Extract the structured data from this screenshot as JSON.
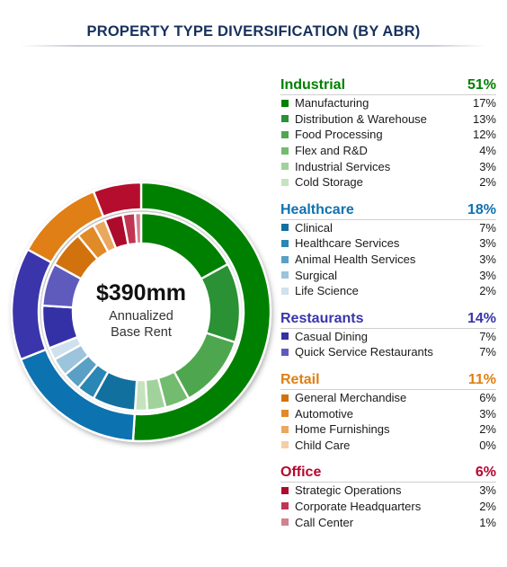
{
  "header": {
    "title": "PROPERTY TYPE DIVERSIFICATION (BY ABR)",
    "title_color": "#17315c"
  },
  "donut": {
    "center": {
      "amount": "$390mm",
      "line1": "Annualized",
      "line2": "Base Rent"
    }
  },
  "chart_data": {
    "type": "pie",
    "title": "PROPERTY TYPE DIVERSIFICATION (BY ABR)",
    "subtype": "nested-donut",
    "center_value": "$390mm",
    "center_label": "Annualized Base Rent",
    "start_angle_deg": 0,
    "direction": "clockwise",
    "units": "percent of ABR",
    "legend_position": "right",
    "groups": [
      {
        "name": "Industrial",
        "total": 51,
        "total_label": "51%",
        "color": "#008000",
        "items": [
          {
            "label": "Manufacturing",
            "value": 17,
            "value_label": "17%",
            "color": "#008000"
          },
          {
            "label": "Distribution & Warehouse",
            "value": 13,
            "value_label": "13%",
            "color": "#2a9134"
          },
          {
            "label": "Food Processing",
            "value": 12,
            "value_label": "12%",
            "color": "#4ea74f"
          },
          {
            "label": "Flex and R&D",
            "value": 4,
            "value_label": "4%",
            "color": "#73bb6f"
          },
          {
            "label": "Industrial Services",
            "value": 3,
            "value_label": "3%",
            "color": "#a2d29b"
          },
          {
            "label": "Cold Storage",
            "value": 2,
            "value_label": "2%",
            "color": "#c6e3bf"
          }
        ]
      },
      {
        "name": "Healthcare",
        "total": 18,
        "total_label": "18%",
        "color": "#1072b0",
        "items": [
          {
            "label": "Clinical",
            "value": 7,
            "value_label": "7%",
            "color": "#12709f"
          },
          {
            "label": "Healthcare Services",
            "value": 3,
            "value_label": "3%",
            "color": "#2a86b4"
          },
          {
            "label": "Animal Health Services",
            "value": 3,
            "value_label": "3%",
            "color": "#5a9fc4"
          },
          {
            "label": "Surgical",
            "value": 3,
            "value_label": "3%",
            "color": "#9cc4dc"
          },
          {
            "label": "Life Science",
            "value": 2,
            "value_label": "2%",
            "color": "#cfe1ed"
          }
        ]
      },
      {
        "name": "Restaurants",
        "total": 14,
        "total_label": "14%",
        "color": "#3a35ab",
        "items": [
          {
            "label": "Casual Dining",
            "value": 7,
            "value_label": "7%",
            "color": "#3430a5"
          },
          {
            "label": "Quick Service Restaurants",
            "value": 7,
            "value_label": "7%",
            "color": "#5f5bbd"
          }
        ]
      },
      {
        "name": "Retail",
        "total": 11,
        "total_label": "11%",
        "color": "#df7f12",
        "items": [
          {
            "label": "General Merchandise",
            "value": 6,
            "value_label": "6%",
            "color": "#d2720d"
          },
          {
            "label": "Automotive",
            "value": 3,
            "value_label": "3%",
            "color": "#e08a28"
          },
          {
            "label": "Home Furnishings",
            "value": 2,
            "value_label": "2%",
            "color": "#eaa85f"
          },
          {
            "label": "Child Care",
            "value": 0,
            "value_label": "0%",
            "color": "#f5cfa4"
          }
        ]
      },
      {
        "name": "Office",
        "total": 6,
        "total_label": "6%",
        "color": "#b5072f",
        "items": [
          {
            "label": "Strategic Operations",
            "value": 3,
            "value_label": "3%",
            "color": "#ad0b2c"
          },
          {
            "label": "Corporate Headquarters",
            "value": 2,
            "value_label": "2%",
            "color": "#c03652"
          },
          {
            "label": "Call Center",
            "value": 1,
            "value_label": "1%",
            "color": "#d2818f"
          }
        ]
      }
    ]
  }
}
